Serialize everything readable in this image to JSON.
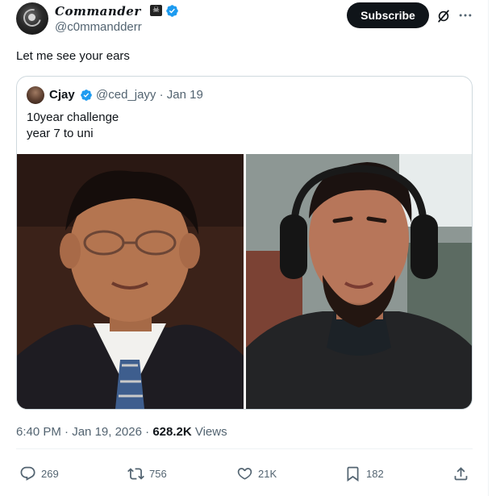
{
  "author": {
    "display_name": "Commander",
    "handle": "@c0mmandderr",
    "badge_icon": "skull-crossbones-icon",
    "verified_icon": "verified-badge-icon"
  },
  "header": {
    "subscribe_label": "Subscribe",
    "grok_icon": "grok-icon",
    "more_icon": "more-options-icon"
  },
  "tweet": {
    "text": "Let me see your ears"
  },
  "quote": {
    "name": "Cjay",
    "handle": "@ced_jayy",
    "date": "Jan 19",
    "line1": "10year challenge",
    "line2": "year 7 to uni"
  },
  "meta": {
    "time": "6:40 PM",
    "date": "Jan 19, 2026",
    "views_count": "628.2K",
    "views_label": "Views"
  },
  "actions": {
    "replies": "269",
    "reposts": "756",
    "likes": "21K",
    "bookmarks": "182"
  },
  "colors": {
    "text": "#0f1419",
    "secondary": "#536471",
    "verified": "#1d9bf0",
    "border": "#cfd9de"
  }
}
